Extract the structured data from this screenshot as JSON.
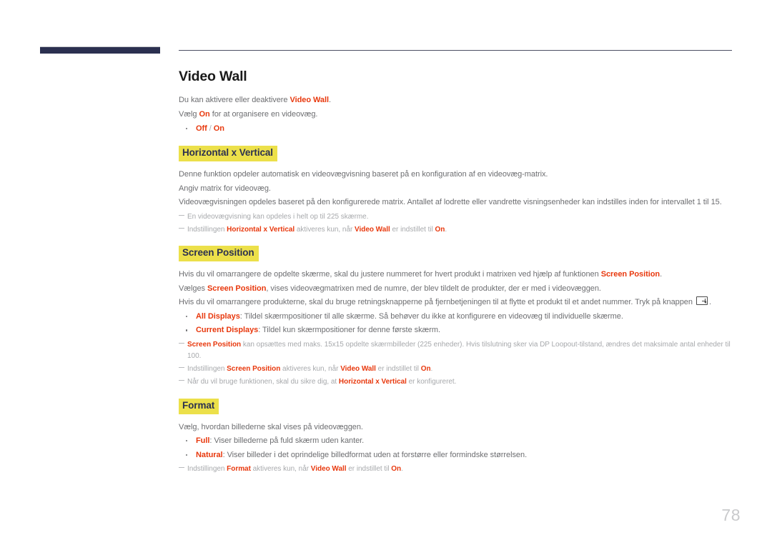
{
  "theme": {
    "accent_red": "#e8380d",
    "highlight_yellow": "#ece04a",
    "heading_navy": "#2b3050",
    "body_gray": "#6d6e71",
    "note_gray": "#a7a9ac"
  },
  "page": {
    "number": "78"
  },
  "title": "Video Wall",
  "intro": {
    "line1_pre": "Du kan aktivere eller deaktivere ",
    "line1_hl": "Video Wall",
    "line1_post": ".",
    "line2_pre": "Vælg ",
    "line2_hl": "On",
    "line2_post": " for at organisere en videovæg.",
    "option": "Off / On",
    "option_off": "Off",
    "option_sep": " / ",
    "option_on": "On"
  },
  "sections": [
    {
      "heading": "Horizontal x Vertical",
      "paragraphs": [
        "Denne funktion opdeler automatisk en videovægvisning baseret på en konfiguration af en videovæg-matrix.",
        "Angiv matrix for videovæg.",
        "Videovægvisningen opdeles baseret på den konfigurerede matrix. Antallet af lodrette eller vandrette visningsenheder kan indstilles inden for intervallet 1 til 15."
      ],
      "notes": [
        {
          "parts": [
            {
              "text": "En videovægvisning kan opdeles i helt op til 225 skærme.",
              "style": "dim"
            }
          ]
        },
        {
          "parts": [
            {
              "text": "Indstillingen ",
              "style": "dim"
            },
            {
              "text": "Horizontal x Vertical",
              "style": "hl"
            },
            {
              "text": " aktiveres kun, når ",
              "style": "dim"
            },
            {
              "text": "Video Wall",
              "style": "hl"
            },
            {
              "text": " er indstillet til ",
              "style": "dim"
            },
            {
              "text": "On",
              "style": "hl"
            },
            {
              "text": ".",
              "style": "dim"
            }
          ]
        }
      ]
    },
    {
      "heading": "Screen Position",
      "paragraphs": [],
      "notes": []
    },
    {
      "heading": "Format",
      "paragraphs": [],
      "notes": []
    }
  ],
  "screen_position": {
    "p1_pre": "Hvis du vil omarrangere de opdelte skærme, skal du justere nummeret for hvert produkt i matrixen ved hjælp af funktionen ",
    "p1_hl": "Screen Position",
    "p1_post": ".",
    "p2_pre": "Vælges ",
    "p2_hl": "Screen Position",
    "p2_post": ", vises videovægmatrixen med de numre, der blev tildelt de produkter, der er med i videovæggen.",
    "p3_pre": "Hvis du vil omarrangere produkterne, skal du bruge retningsknapperne på fjernbetjeningen til at flytte et produkt til et andet nummer. Tryk på knappen ",
    "p3_post": ".",
    "opt1_label": "All Displays",
    "opt1_text": ": Tildel skærmpositioner til alle skærme. Så behøver du ikke at konfigurere en videovæg til individuelle skærme.",
    "opt2_label": "Current Displays",
    "opt2_text": ": Tildel kun skærmpositioner for denne første skærm.",
    "note1_hl": "Screen Position",
    "note1_text": " kan opsættes med maks. 15x15 opdelte skærmbilleder (225 enheder). Hvis tilslutning sker via DP Loopout-tilstand, ændres det maksimale antal enheder til 100.",
    "note2_pre": "Indstillingen ",
    "note2_hl1": "Screen Position",
    "note2_mid": " aktiveres kun, når ",
    "note2_hl2": "Video Wall",
    "note2_mid2": " er indstillet til ",
    "note2_hl3": "On",
    "note2_post": ".",
    "note3_pre": "Når du vil bruge funktionen, skal du sikre dig, at ",
    "note3_hl": "Horizontal x Vertical",
    "note3_post": " er konfigureret."
  },
  "format": {
    "p1": "Vælg, hvordan billederne skal vises på videovæggen.",
    "opt1_label": "Full",
    "opt1_text": ": Viser billederne på fuld skærm uden kanter.",
    "opt2_label": "Natural",
    "opt2_text": ": Viser billeder i det oprindelige billedformat uden at forstørre eller formindske størrelsen.",
    "note1_pre": "Indstillingen ",
    "note1_hl1": "Format",
    "note1_mid": " aktiveres kun, når ",
    "note1_hl2": "Video Wall",
    "note1_mid2": " er indstillet til ",
    "note1_hl3": "On",
    "note1_post": "."
  },
  "icons": {
    "enter_key": "enter-key-icon"
  }
}
